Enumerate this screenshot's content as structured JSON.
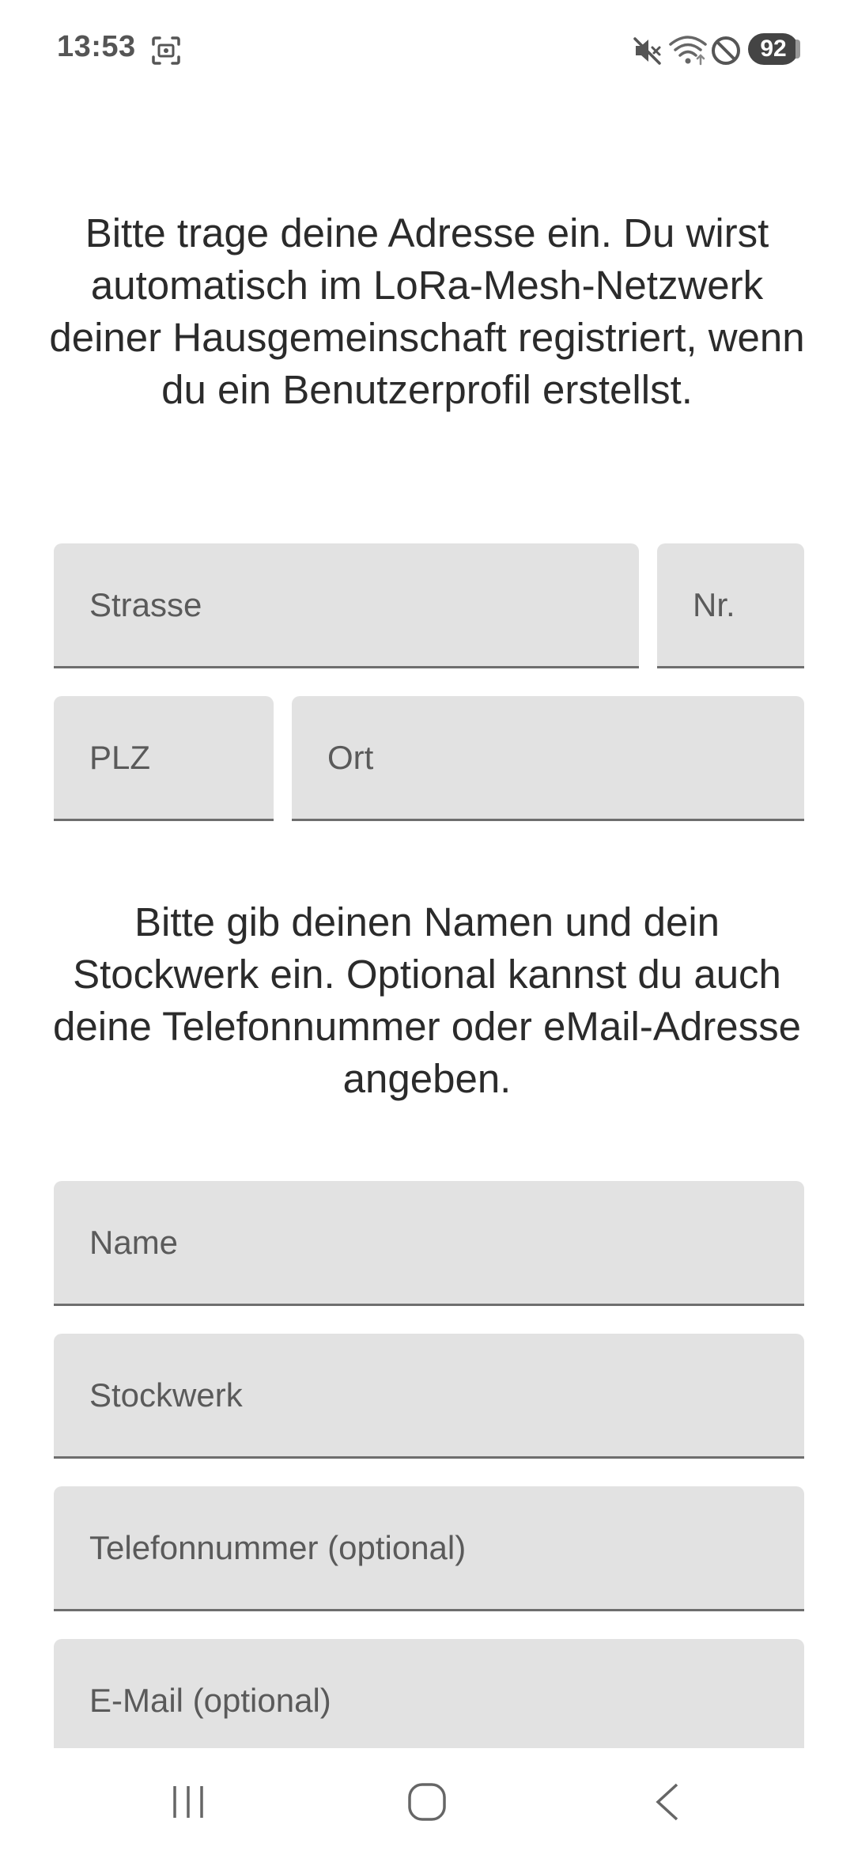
{
  "status_bar": {
    "time": "13:53",
    "battery": "92",
    "icons": [
      "screenshot-icon",
      "mute-icon",
      "wifi-icon",
      "do-not-disturb-icon"
    ]
  },
  "address_section": {
    "intro": "Bitte trage deine Adresse ein. Du wirst automatisch im LoRa-Mesh-Netzwerk deiner Hausgemeinschaft registriert, wenn du ein Benutzerprofil erstellst.",
    "street_placeholder": "Strasse",
    "number_placeholder": "Nr.",
    "zip_placeholder": "PLZ",
    "city_placeholder": "Ort"
  },
  "profile_section": {
    "intro": "Bitte gib deinen Namen und dein Stockwerk ein. Optional kannst du auch deine Telefonnummer oder eMail-Adresse angeben.",
    "name_placeholder": "Name",
    "floor_placeholder": "Stockwerk",
    "phone_placeholder": "Telefonnummer (optional)",
    "email_placeholder": "E-Mail (optional)"
  },
  "nav_bar": {
    "icons": [
      "recent-apps-icon",
      "home-icon",
      "back-icon"
    ]
  },
  "colors": {
    "field_background": "#e2e2e2",
    "field_underline": "#6e6e6e",
    "text": "#2b2b2b",
    "placeholder": "#5a5a5a"
  }
}
